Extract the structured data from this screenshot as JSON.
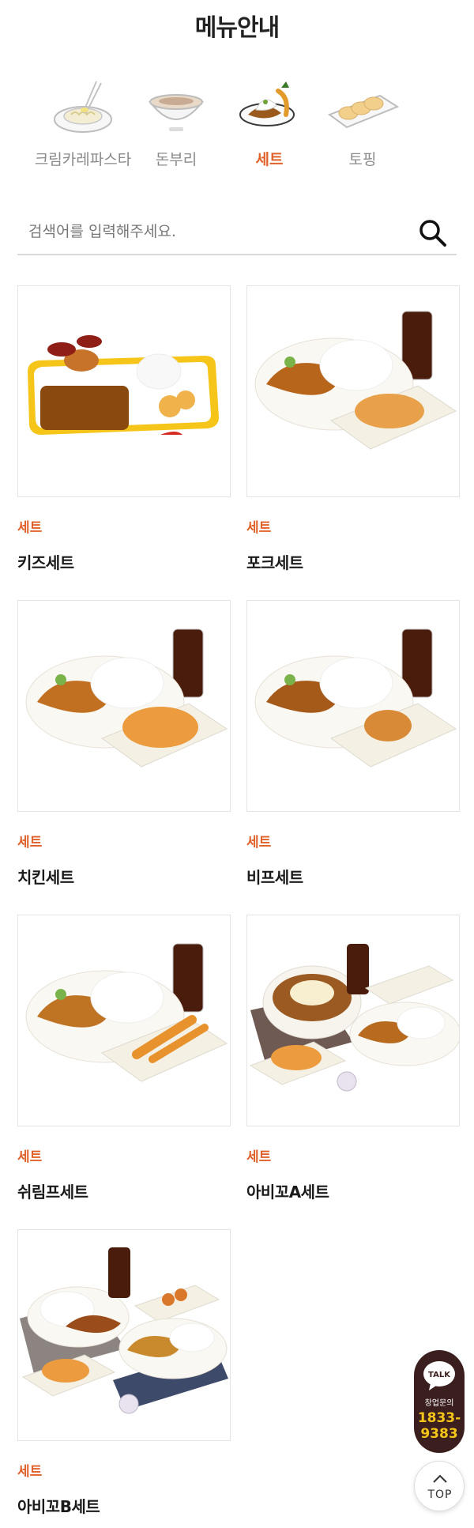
{
  "header": {
    "title": "메뉴안내"
  },
  "categories": [
    {
      "label": "크림카레파스타",
      "icon": "pasta-plate-icon",
      "active": false
    },
    {
      "label": "돈부리",
      "icon": "rice-bowl-icon",
      "active": false
    },
    {
      "label": "세트",
      "icon": "set-plate-icon",
      "active": true
    },
    {
      "label": "토핑",
      "icon": "topping-plate-icon",
      "active": false
    }
  ],
  "search": {
    "placeholder": "검색어를 입력해주세요.",
    "value": ""
  },
  "menu_items": [
    {
      "category": "세트",
      "name": "키즈세트",
      "image": "kids-set-image"
    },
    {
      "category": "세트",
      "name": "포크세트",
      "image": "pork-set-image"
    },
    {
      "category": "세트",
      "name": "치킨세트",
      "image": "chicken-set-image"
    },
    {
      "category": "세트",
      "name": "비프세트",
      "image": "beef-set-image"
    },
    {
      "category": "세트",
      "name": "쉬림프세트",
      "image": "shrimp-set-image"
    },
    {
      "category": "세트",
      "name": "아비꼬A세트",
      "image": "abiko-a-set-image"
    },
    {
      "category": "세트",
      "name": "아비꼬B세트",
      "image": "abiko-b-set-image"
    }
  ],
  "floating": {
    "talk": {
      "badge": "TALK",
      "label": "창업문의",
      "phone_line1": "1833-",
      "phone_line2": "9383"
    },
    "top": {
      "label": "TOP"
    }
  },
  "colors": {
    "accent": "#e0622a",
    "text": "#222222",
    "muted": "#8a8a8a",
    "talk_bg": "#3b1f1f",
    "talk_phone": "#f5c518"
  }
}
